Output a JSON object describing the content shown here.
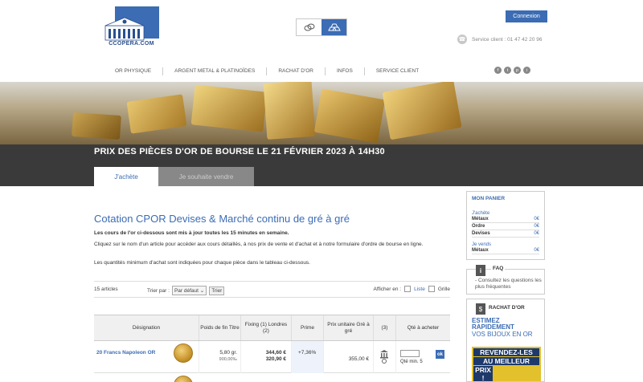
{
  "brand": {
    "logo_text": "CCOPERA.COM"
  },
  "header": {
    "connexion_label": "Connexion",
    "service_client": "Service client : 01 47 42 20 96",
    "social": [
      "f",
      "t",
      "p",
      "i"
    ]
  },
  "nav": {
    "items": [
      "OR PHYSIQUE",
      "ARGENT METAL & PLATINOÏDES",
      "RACHAT D'OR",
      "INFOS",
      "SERVICE CLIENT"
    ]
  },
  "page": {
    "title": "PRIX DES PIÈCES D'OR DE BOURSE LE 21 FÉVRIER 2023 À 14H30",
    "tabs": [
      "J'achète",
      "Je souhaite vendre"
    ]
  },
  "main": {
    "heading": "Cotation CPOR Devises & Marché continu de gré à gré",
    "para1": "Les cours de l'or ci-dessous sont mis à jour toutes les 15 minutes en semaine.",
    "para2": "Cliquez sur le nom d'un article pour accéder aux cours détaillés, à nos prix de vente et d'achat et à notre formulaire d'ordre de bourse en ligne.",
    "para3": "Les quantités minimum d'achat sont indiquées pour chaque pièce dans le tableau ci-dessous."
  },
  "listbar": {
    "count": "15 articles",
    "sort_label": "Trier par :",
    "sort_value": "Par défaut",
    "sort_button": "Trier",
    "display_label": "Afficher en :",
    "list_label": "Liste",
    "grid_label": "Grille"
  },
  "table": {
    "headers": {
      "designation": "Désignation",
      "poids": "Poids de fin Titre",
      "fixing": "Fixing (1) Londres (2)",
      "prime": "Prime",
      "prix": "Prix unitaire Gré à gré",
      "note": "(3)",
      "qty": "Qté à acheter"
    },
    "rows": [
      {
        "name": "20 Francs Napoleon OR",
        "poids": "5,80 gr.",
        "titre": "900,00‰",
        "fixing1": "344,60 €",
        "fixing2": "320,90 €",
        "prime": "+7,36%",
        "prix": "355,00 €",
        "qty_min": "Qté min. 5",
        "ok": "ok"
      }
    ]
  },
  "sidebar": {
    "panier": {
      "title": "MON PANIER",
      "achete": "J'achète",
      "achete_rows": [
        {
          "label": "Métaux",
          "value": "0€"
        },
        {
          "label": "Ordre",
          "value": "0€"
        },
        {
          "label": "Devises",
          "value": "0€"
        }
      ],
      "vends": "Je vends",
      "vends_rows": [
        {
          "label": "Métaux",
          "value": "0€"
        }
      ]
    },
    "faq": {
      "title": "FAQ",
      "text": "- Consultez les questions les plus fréquentes"
    },
    "rachat": {
      "title": "RACHAT D'OR",
      "line1": "ESTIMEZ",
      "line2": "RAPIDEMENT",
      "line3": "VOS BIJOUX EN OR",
      "yellow": [
        "REVENDEZ-LES",
        "AU MEILLEUR",
        "PRIX !"
      ]
    }
  }
}
